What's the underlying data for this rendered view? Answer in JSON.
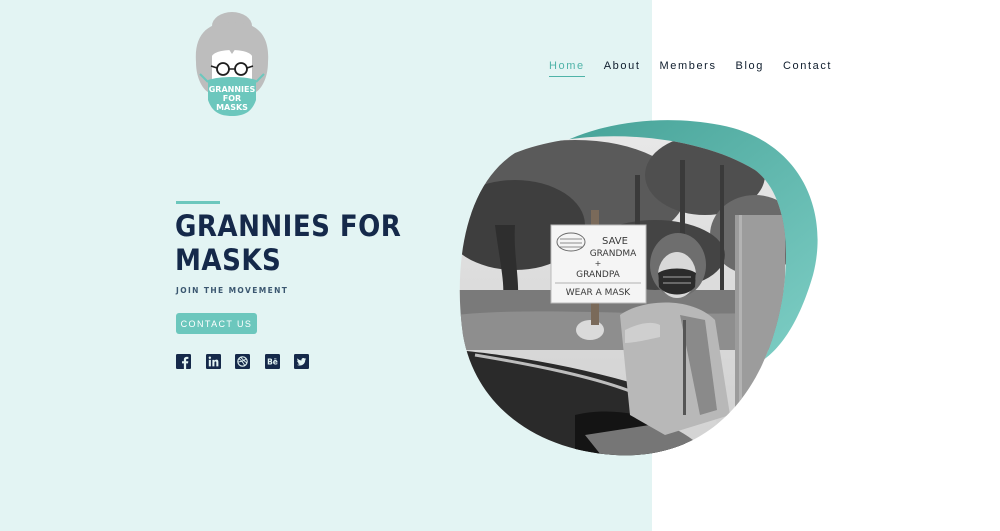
{
  "brand": {
    "logo_text_line1": "GRANNIES",
    "logo_text_line2": "FOR",
    "logo_text_line3": "MASKS"
  },
  "nav": {
    "items": [
      {
        "label": "Home",
        "active": true
      },
      {
        "label": "About",
        "active": false
      },
      {
        "label": "Members",
        "active": false
      },
      {
        "label": "Blog",
        "active": false
      },
      {
        "label": "Contact",
        "active": false
      }
    ]
  },
  "hero": {
    "title_line1": "GRANNIES FOR",
    "title_line2": "MASKS",
    "subtitle": "JOIN THE MOVEMENT",
    "cta_label": "CONTACT US"
  },
  "social": {
    "icons": [
      "facebook-icon",
      "linkedin-icon",
      "dribbble-icon",
      "behance-icon",
      "twitter-icon"
    ]
  },
  "photo": {
    "sign_line1": "SAVE",
    "sign_line2": "GRANDMA",
    "sign_line3": "+",
    "sign_line4": "GRANDPA",
    "sign_line5": "WEAR A MASK"
  },
  "colors": {
    "panel_bg": "#e3f4f3",
    "accent": "#6cc7bd",
    "accent_dark": "#4aa69b",
    "navy": "#15294a"
  }
}
